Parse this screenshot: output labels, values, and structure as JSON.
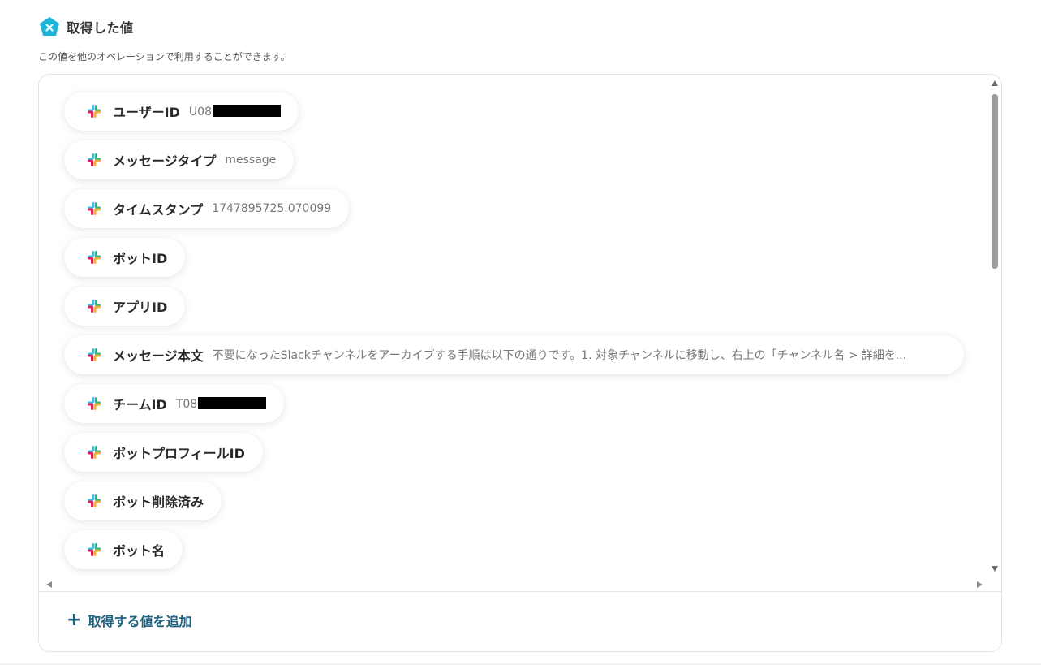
{
  "header": {
    "title": "取得した値",
    "description": "この値を他のオペレーションで利用することができます。",
    "icon": "yoom-x-icon",
    "icon_color": "#1fb3d8"
  },
  "items": [
    {
      "label": "ユーザーID",
      "value": "U08",
      "redacted": true,
      "icon": "slack-icon"
    },
    {
      "label": "メッセージタイプ",
      "value": "message",
      "icon": "slack-icon"
    },
    {
      "label": "タイムスタンプ",
      "value": "1747895725.070099",
      "icon": "slack-icon"
    },
    {
      "label": "ボットID",
      "value": "",
      "icon": "slack-icon"
    },
    {
      "label": "アプリID",
      "value": "",
      "icon": "slack-icon"
    },
    {
      "label": "メッセージ本文",
      "value": "不要になったSlackチャンネルをアーカイブする手順は以下の通りです。1. 対象チャンネルに移動し、右上の「チャンネル名 > 詳細を...",
      "icon": "slack-icon"
    },
    {
      "label": "チームID",
      "value": "T08",
      "redacted": true,
      "icon": "slack-icon"
    },
    {
      "label": "ボットプロフィールID",
      "value": "",
      "icon": "slack-icon"
    },
    {
      "label": "ボット削除済み",
      "value": "",
      "icon": "slack-icon"
    },
    {
      "label": "ボット名",
      "value": "",
      "icon": "slack-icon"
    }
  ],
  "footer": {
    "add_label": "取得する値を追加",
    "add_icon": "plus-icon",
    "accent_color": "#1f6280"
  }
}
